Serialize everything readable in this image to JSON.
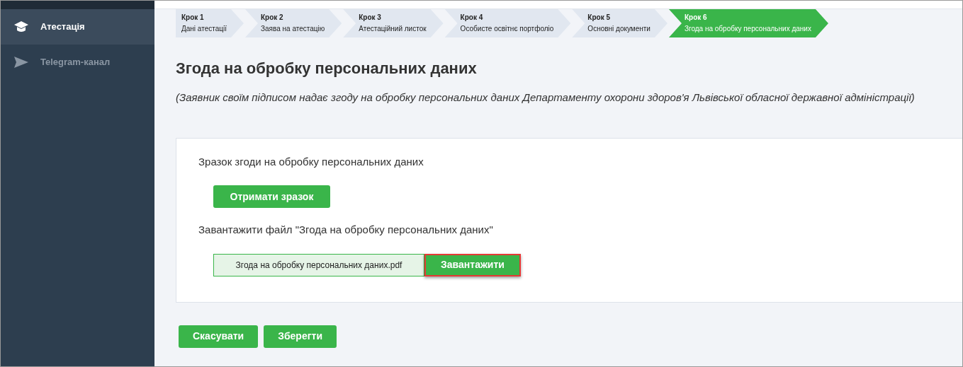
{
  "sidebar": {
    "items": [
      {
        "label": "Атестація",
        "selected": true
      },
      {
        "label": "Telegram-канал",
        "selected": false
      }
    ]
  },
  "steps": [
    {
      "number": "Крок 1",
      "label": "Дані атестації",
      "selected": false
    },
    {
      "number": "Крок 2",
      "label": "Заява на атестацію",
      "selected": false
    },
    {
      "number": "Крок 3",
      "label": "Атестаційний листок",
      "selected": false
    },
    {
      "number": "Крок 4",
      "label": "Особисте освітнє портфоліо",
      "selected": false
    },
    {
      "number": "Крок 5",
      "label": "Основні документи",
      "selected": false
    },
    {
      "number": "Крок 6",
      "label": "Згода на обробку персональних даних",
      "selected": true
    }
  ],
  "heading": "Згода на обробку персональних даних",
  "subtitle": "(Заявник своїм підписом надає згоду на обробку персональних даних Департаменту охорони здоров'я Львівської обласної державної адміністрації)",
  "card": {
    "sample_label": "Зразок згоди на обробку персональних даних",
    "sample_button": "Отримати зразок",
    "upload_label": "Завантажити файл \"Згода на обробку персональних даних\"",
    "file_name": "Згода на обробку персональних даних.pdf",
    "upload_button": {
      "label": "Завантажити",
      "highlighted": true
    }
  },
  "buttons": [
    "Скасувати",
    "Зберегти"
  ]
}
